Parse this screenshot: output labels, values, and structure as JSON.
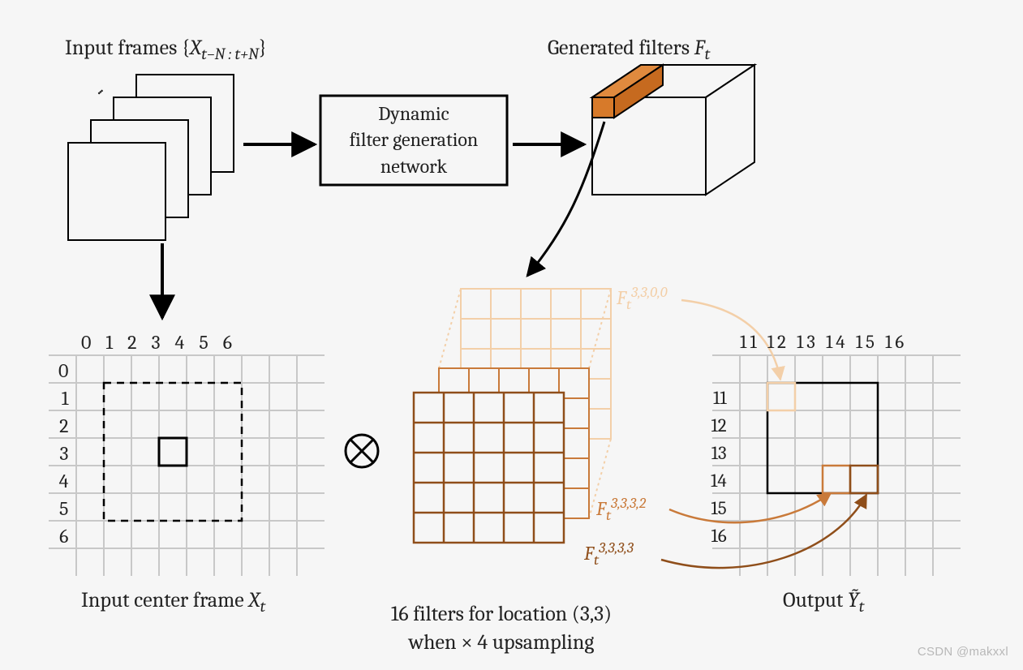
{
  "labels": {
    "input_frames_prefix": "Input frames {",
    "input_frames_sub": "X",
    "input_frames_subscript": "t−N : t+N",
    "input_frames_suffix": "}",
    "network_l1": "Dynamic",
    "network_l2": "filter generation",
    "network_l3": "network",
    "generated_filters": "Generated filters ",
    "generated_filters_sym": "F",
    "generated_filters_sub": "t",
    "input_center_frame": "Input center frame ",
    "input_center_sym": "X",
    "input_center_sub": "t",
    "sixteen_filters_l1_a": "16 filters for location ",
    "sixteen_filters_l1_b": "(3,3)",
    "sixteen_filters_l2": "when × 4 upsampling",
    "output_prefix": "Output ",
    "output_sym": "Ỹ",
    "output_sub": "t",
    "f_sym": "F",
    "f_sub": "t",
    "f_sup_a": "3,3,0,0",
    "f_sup_b": "3,3,3,2",
    "f_sup_c": "3,3,3,3",
    "tensor_op": "⊗",
    "ellipsis": "···"
  },
  "grid": {
    "col_labels": [
      "0",
      "1",
      "2",
      "3",
      "4",
      "5",
      "6"
    ],
    "row_labels": [
      "0",
      "1",
      "2",
      "3",
      "4",
      "5",
      "6"
    ]
  },
  "output_grid": {
    "col_labels": [
      "11",
      "12",
      "13",
      "14",
      "15",
      "16"
    ],
    "row_labels": [
      "11",
      "12",
      "13",
      "14",
      "15",
      "16"
    ]
  },
  "watermark": "CSDN @makxxl",
  "colors": {
    "light_orange": "#f3cfa8",
    "mid_orange": "#c97a3a",
    "dark_orange": "#8f4e1a",
    "grid_grey": "#c8c8c8"
  }
}
